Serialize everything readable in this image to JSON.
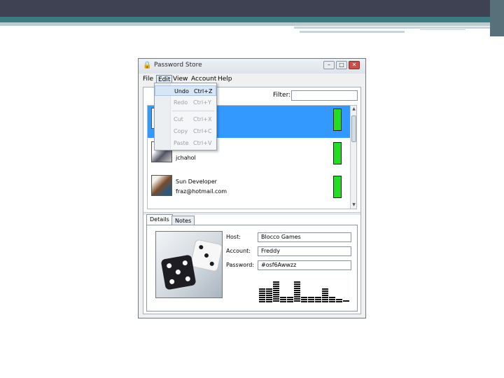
{
  "window": {
    "title": "Password Store"
  },
  "menubar": {
    "items": [
      "File",
      "Edit",
      "View",
      "Account",
      "Help"
    ]
  },
  "edit_menu": {
    "items": [
      {
        "label": "Undo",
        "accel": "Ctrl+Z",
        "enabled": true
      },
      {
        "label": "Redo",
        "accel": "Ctrl+Y",
        "enabled": false
      },
      {
        "label": "Cut",
        "accel": "Ctrl+X",
        "enabled": false
      },
      {
        "label": "Copy",
        "accel": "Ctrl+C",
        "enabled": false
      },
      {
        "label": "Paste",
        "accel": "Ctrl+V",
        "enabled": false
      }
    ]
  },
  "filter": {
    "label": "Filter:",
    "value": ""
  },
  "accounts": [
    {
      "name": "",
      "email": "",
      "selected": true,
      "strength_color": "#22dd22"
    },
    {
      "name": "",
      "email": "jchahol",
      "selected": false,
      "strength_color": "#22dd22"
    },
    {
      "name": "Sun Developer",
      "email": "fraz@hotmail.com",
      "selected": false,
      "strength_color": "#22dd22"
    }
  ],
  "tabs": [
    "Details",
    "Notes"
  ],
  "details": {
    "host_label": "Host:",
    "host_value": "Blocco Games",
    "account_label": "Account:",
    "account_value": "Freddy",
    "password_label": "Password:",
    "password_value": "#osf6Awwzz"
  },
  "colors": {
    "selection": "#3399ff",
    "strength_good": "#22dd22"
  }
}
